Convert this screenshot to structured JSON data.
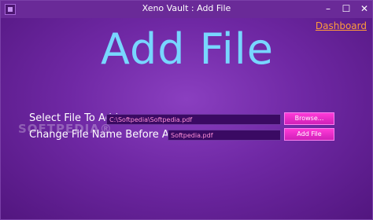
{
  "window": {
    "title": "Xeno Vault : Add File",
    "controls": {
      "minimize": "–",
      "maximize": "☐",
      "close": "✕"
    }
  },
  "nav": {
    "dashboard_label": "Dashboard"
  },
  "main": {
    "heading": "Add File",
    "select_file_label": "Select File To Add:",
    "select_file_value": "C:\\Softpedia\\Softpedia.pdf",
    "browse_label": "Browse...",
    "change_name_label": "Change File Name Before Adding:",
    "change_name_value": "Softpedia.pdf",
    "add_file_label": "Add File"
  },
  "watermark": "SOFTPEDIA®",
  "colors": {
    "background": "#6f28a4",
    "heading": "#78d6ff",
    "dashboard_link": "#ff9b3a",
    "button": "#e82bc8",
    "field_text": "#ff8fd8"
  }
}
